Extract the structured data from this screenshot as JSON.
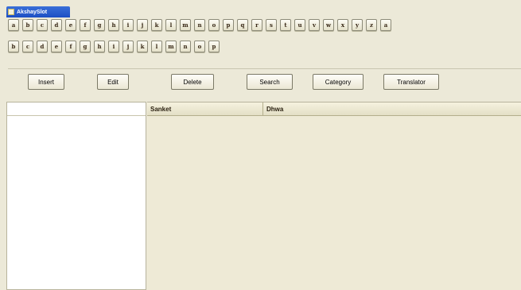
{
  "window": {
    "title": "AkshaySlot"
  },
  "keyboard": {
    "row1": [
      "a",
      "b",
      "c",
      "d",
      "e",
      "f",
      "g",
      "h",
      "i",
      "j",
      "k",
      "l",
      "m",
      "n",
      "o",
      "p",
      "q",
      "r",
      "s",
      "t",
      "u",
      "v",
      "w",
      "x",
      "y",
      "z",
      "a"
    ],
    "row2": [
      "b",
      "c",
      "d",
      "e",
      "f",
      "g",
      "h",
      "i",
      "j",
      "k",
      "l",
      "m",
      "n",
      "o",
      "p"
    ]
  },
  "actions": {
    "insert": "Insert",
    "edit": "Edit",
    "delete": "Delete",
    "search": "Search",
    "category": "Category",
    "translator": "Translator"
  },
  "grid": {
    "columns": [
      "Sanket",
      "Dhwa"
    ]
  }
}
